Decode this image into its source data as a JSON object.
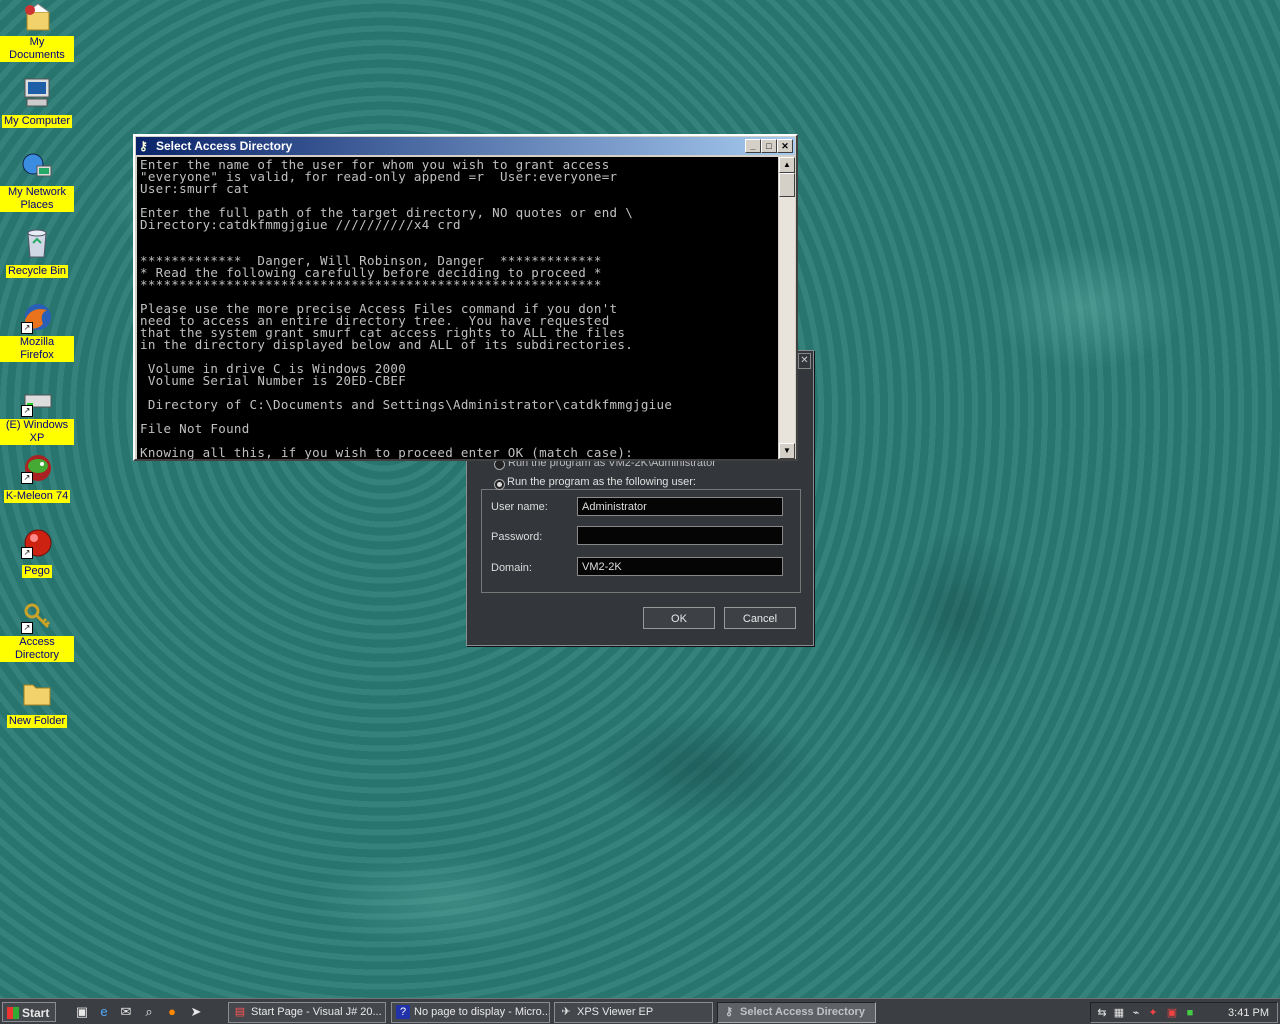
{
  "desktop": {
    "icons": [
      {
        "label": "My Documents"
      },
      {
        "label": "My Computer"
      },
      {
        "label": "My Network Places"
      },
      {
        "label": "Recycle Bin"
      },
      {
        "label": "Mozilla Firefox"
      },
      {
        "label": "(E) Windows XP"
      },
      {
        "label": "K-Meleon 74"
      },
      {
        "label": "Pego"
      },
      {
        "label": "Access Directory"
      },
      {
        "label": "New Folder"
      }
    ]
  },
  "runas_dialog": {
    "option_current": "Run the program as VM2-2K\\Administrator",
    "option_other": "Run the program as the following user:",
    "username_label": "User name:",
    "username_value": "Administrator",
    "password_label": "Password:",
    "password_value": "",
    "domain_label": "Domain:",
    "domain_value": "VM2-2K",
    "ok_label": "OK",
    "cancel_label": "Cancel"
  },
  "console": {
    "title": "Select Access Directory",
    "text": "Enter the name of the user for whom you wish to grant access\n\"everyone\" is valid, for read-only append =r  User:everyone=r\nUser:smurf cat\n\nEnter the full path of the target directory, NO quotes or end \\\nDirectory:catdkfmmgjgiue //////////x4 crd\n\n\n*************  Danger, Will Robinson, Danger  *************\n* Read the following carefully before deciding to proceed *\n***********************************************************\n\nPlease use the more precise Access Files command if you don't\nneed to access an entire directory tree.  You have requested\nthat the system grant smurf cat access rights to ALL the files\nin the directory displayed below and ALL of its subdirectories.\n\n Volume in drive C is Windows 2000\n Volume Serial Number is 20ED-CBEF\n\n Directory of C:\\Documents and Settings\\Administrator\\catdkfmmgjgiue\n\nFile Not Found\n\nKnowing all this, if you wish to proceed enter OK (match case):"
  },
  "taskbar": {
    "start_label": "Start",
    "tasks": [
      {
        "label": "Start Page - Visual J# 20..."
      },
      {
        "label": "No page to display - Micro..."
      },
      {
        "label": "XPS Viewer EP"
      },
      {
        "label": "Select Access Directory"
      }
    ],
    "clock": "3:41 PM"
  },
  "colors": {
    "desktop_bg": "#2a7a74",
    "icon_label_bg": "#ffff00",
    "title_active": "#0a246a",
    "console_bg": "#000000",
    "console_fg": "#c0c0c0"
  }
}
